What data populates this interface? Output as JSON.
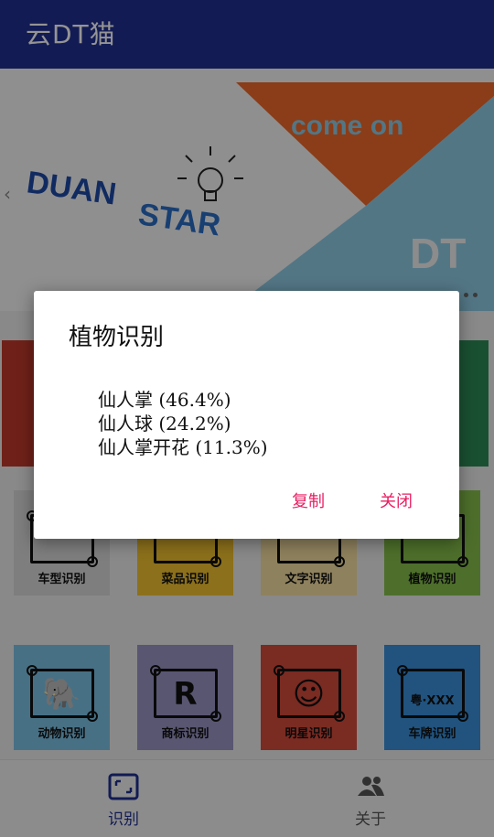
{
  "app": {
    "title": "云DT猫"
  },
  "banner": {
    "text_duan": "DUAN",
    "text_star": "STAR",
    "text_come_on": "come on",
    "text_dt": "DT",
    "arrow_left": "‹"
  },
  "tiles": [
    {
      "label": "车型识别",
      "icon": "car-icon",
      "color": "#d9d9d9"
    },
    {
      "label": "菜品识别",
      "icon": "dish-icon",
      "color": "#f2c230"
    },
    {
      "label": "文字识别",
      "icon": "text-icon",
      "color": "#f5dfa0"
    },
    {
      "label": "植物识别",
      "icon": "plant-icon",
      "color": "#86c04a"
    },
    {
      "label": "动物识别",
      "icon": "elephant-icon",
      "glyph": "🐘",
      "color": "#7cc1e3"
    },
    {
      "label": "商标识别",
      "icon": "trademark-icon",
      "glyph": "R",
      "color": "#9a95c4"
    },
    {
      "label": "明星识别",
      "icon": "star-person-icon",
      "glyph": "☺",
      "color": "#d24a3c"
    },
    {
      "label": "车牌识别",
      "icon": "license-plate-icon",
      "glyph": "粤·XXX",
      "color": "#3a8fd9"
    }
  ],
  "bottom_nav": [
    {
      "label": "识别",
      "icon": "scan-frame-icon",
      "active": true
    },
    {
      "label": "关于",
      "icon": "people-icon",
      "active": false
    }
  ],
  "dialog": {
    "title": "植物识别",
    "results": [
      "仙人掌 (46.4%)",
      "仙人球 (24.2%)",
      "仙人掌开花 (11.3%)"
    ],
    "copy_label": "复制",
    "close_label": "关闭"
  },
  "colors": {
    "appbar": "#1f2f8f",
    "accent": "#e91e63",
    "nav_active": "#1f2f8f"
  }
}
